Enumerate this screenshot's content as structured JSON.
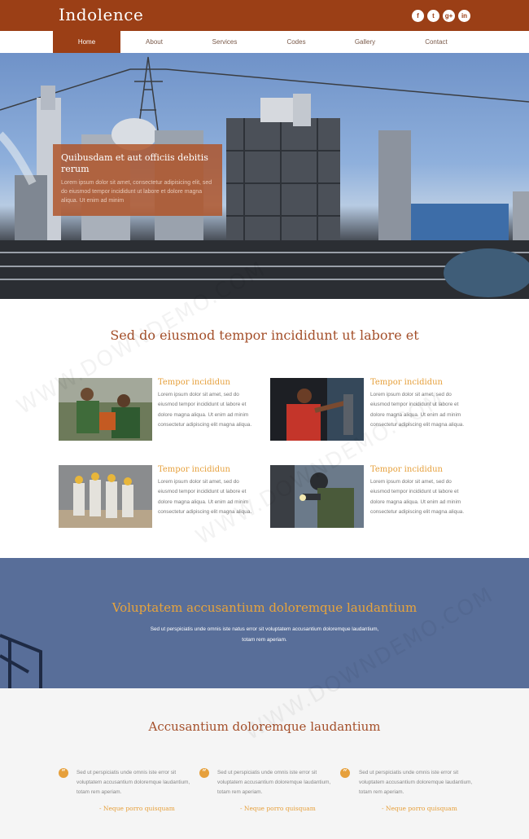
{
  "brand": "Indolence",
  "social": [
    {
      "glyph": "f",
      "icon": "facebook-icon"
    },
    {
      "glyph": "t",
      "icon": "twitter-icon"
    },
    {
      "glyph": "g+",
      "icon": "google-plus-icon"
    },
    {
      "glyph": "in",
      "icon": "linkedin-icon"
    }
  ],
  "nav": [
    "Home",
    "About",
    "Services",
    "Codes",
    "Gallery",
    "Contact"
  ],
  "nav_active": "Home",
  "hero": {
    "title": "Quibusdam et aut officiis debitis rerum",
    "text": "Lorem ipsum dolor sit amet, consectetur adipisicing elit, sed do eiusmod tempor incididunt ut labore et dolore magna aliqua. Ut enim ad minim"
  },
  "section1": {
    "title": "Sed do eiusmod tempor incididunt ut labore et",
    "cards": [
      {
        "title": "Tempor incididun",
        "text": "Lorem ipsum dolor sit amet, sed do eiusmod tempor incididunt ut labore et dolore magna aliqua. Ut enim ad minim consectetur adipiscing elit magna aliqua."
      },
      {
        "title": "Tempor incididun",
        "text": "Lorem ipsum dolor sit amet, sed do eiusmod tempor incididunt ut labore et dolore magna aliqua. Ut enim ad minim consectetur adipiscing elit magna aliqua."
      },
      {
        "title": "Tempor incididun",
        "text": "Lorem ipsum dolor sit amet, sed do eiusmod tempor incididunt ut labore et dolore magna aliqua. Ut enim ad minim consectetur adipiscing elit magna aliqua."
      },
      {
        "title": "Tempor incididun",
        "text": "Lorem ipsum dolor sit amet, sed do eiusmod tempor incididunt ut labore et dolore magna aliqua. Ut enim ad minim consectetur adipiscing elit magna aliqua."
      }
    ]
  },
  "band": {
    "title": "Voluptatem accusantium doloremque laudantium",
    "text": "Sed ut perspiciatis unde omnis iste natus error sit voluptatem accusantium doloremque laudantium, totam rem aperiam."
  },
  "section3": {
    "title": "Accusantium doloremque laudantium",
    "quotes": [
      {
        "text": "Sed ut perspiciatis unde omnis iste error sit voluptatem accusantium doloremque laudantium, totam rem aperiam.",
        "author": "- Neque porro quisquam"
      },
      {
        "text": "Sed ut perspiciatis unde omnis iste error sit voluptatem accusantium doloremque laudantium, totam rem aperiam.",
        "author": "- Neque porro quisquam"
      },
      {
        "text": "Sed ut perspiciatis unde omnis iste error sit voluptatem accusantium doloremque laudantium, totam rem aperiam.",
        "author": "- Neque porro quisquam"
      }
    ]
  },
  "watermark": "WWW.DOWNDEMO.COM",
  "colors": {
    "brand": "#9b3f16",
    "accent": "#e6a03c",
    "band": "#586e99"
  }
}
